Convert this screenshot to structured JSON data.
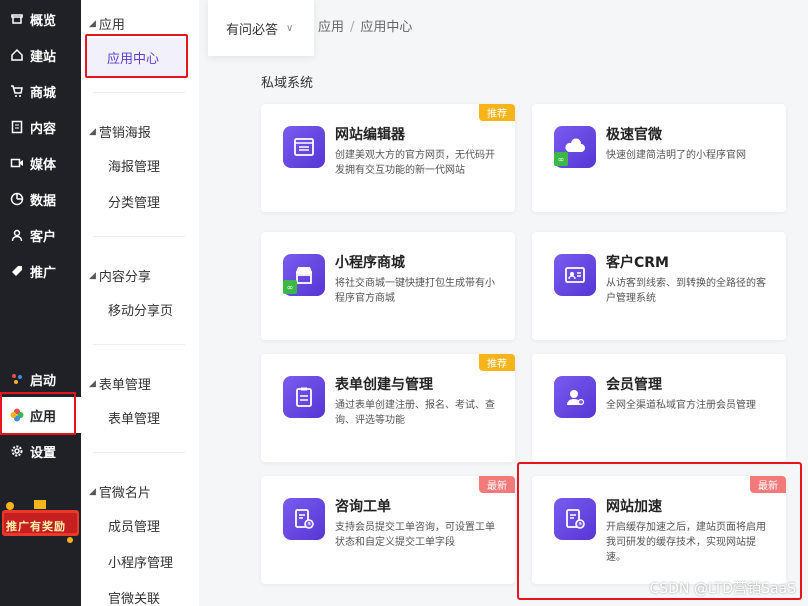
{
  "rail": {
    "items": [
      {
        "label": "概览",
        "icon": "dashboard-icon"
      },
      {
        "label": "建站",
        "icon": "home-icon"
      },
      {
        "label": "商城",
        "icon": "cart-icon"
      },
      {
        "label": "内容",
        "icon": "document-icon"
      },
      {
        "label": "媒体",
        "icon": "video-icon"
      },
      {
        "label": "数据",
        "icon": "chart-icon"
      },
      {
        "label": "客户",
        "icon": "user-icon"
      },
      {
        "label": "推广",
        "icon": "tag-icon"
      }
    ],
    "bottom": [
      {
        "label": "启动",
        "icon": "launch-icon"
      },
      {
        "label": "应用",
        "icon": "apps-icon"
      },
      {
        "label": "设置",
        "icon": "gear-icon"
      }
    ],
    "promo_text": "推广有奖励"
  },
  "subnav": {
    "groups": [
      {
        "title": "应用",
        "items": [
          "应用中心"
        ]
      },
      {
        "title": "营销海报",
        "items": [
          "海报管理",
          "分类管理"
        ]
      },
      {
        "title": "内容分享",
        "items": [
          "移动分享页"
        ]
      },
      {
        "title": "表单管理",
        "items": [
          "表单管理"
        ]
      },
      {
        "title": "官微名片",
        "items": [
          "成员管理",
          "小程序管理",
          "官微关联"
        ]
      }
    ]
  },
  "topbar": {
    "dropdown_label": "有问必答",
    "breadcrumb": [
      "应用",
      "应用中心"
    ]
  },
  "section_label": "私域系统",
  "cards": [
    {
      "title": "网站编辑器",
      "desc": "创建美观大方的官方网页，无代码开发拥有交互功能的新一代网站",
      "badge": "推荐"
    },
    {
      "title": "极速官微",
      "desc": "快速创建简洁明了的小程序官网",
      "badge": ""
    },
    {
      "title": "小程序商城",
      "desc": "将社交商城一键快捷打包生成带有小程序官方商城",
      "badge": ""
    },
    {
      "title": "客户CRM",
      "desc": "从访客到线索、到转换的全路径的客户管理系统",
      "badge": ""
    },
    {
      "title": "表单创建与管理",
      "desc": "通过表单创建注册、报名、考试、查询、评选等功能",
      "badge": "推荐"
    },
    {
      "title": "会员管理",
      "desc": "全网全渠道私域官方注册会员管理",
      "badge": ""
    },
    {
      "title": "咨询工单",
      "desc": "支持会员提交工单咨询，可设置工单状态和自定义提交工单字段",
      "badge": "最新"
    },
    {
      "title": "网站加速",
      "desc": "开启缓存加速之后，建站页面将启用我司研发的缓存技术，实现网站提速。",
      "badge": "最新"
    }
  ],
  "watermark": "CSDN @LTD营销SaaS"
}
